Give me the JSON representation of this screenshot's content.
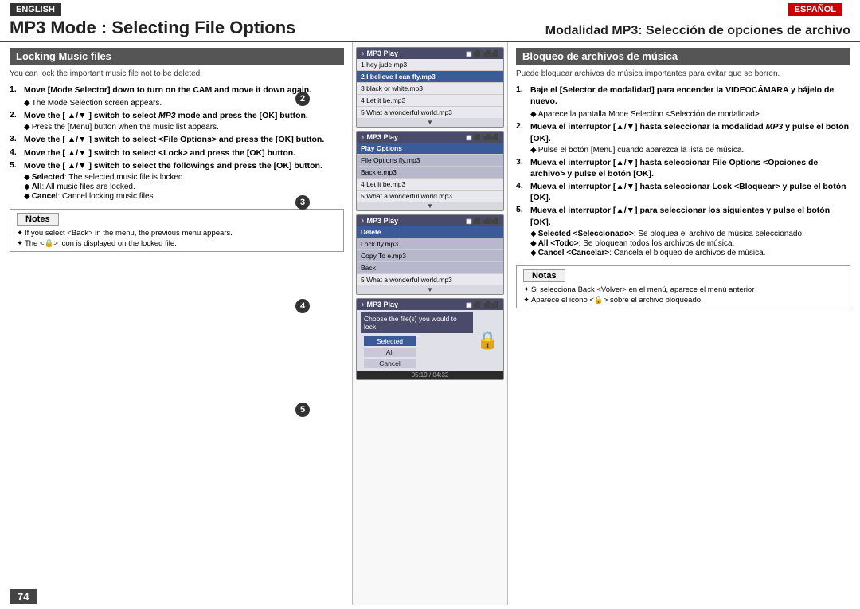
{
  "header": {
    "lang_en": "ENGLISH",
    "lang_es": "ESPAÑOL",
    "title_en": "MP3 Mode : Selecting File Options",
    "title_es": "Modalidad MP3: Selección de opciones de archivo"
  },
  "left": {
    "section_title": "Locking Music files",
    "intro": "You can lock the important music file not to be deleted.",
    "steps": [
      {
        "num": "1.",
        "text": "Move [Mode Selector] down to turn on the CAM and move it down again.",
        "sub": [
          "The Mode Selection screen appears."
        ]
      },
      {
        "num": "2.",
        "text_prefix": "Move the [ ▲/▼ ] switch to select ",
        "italic": "MP3",
        "text_suffix": " mode and press the [OK] button.",
        "sub": [
          "Press the [Menu] button when the music list appears."
        ]
      },
      {
        "num": "3.",
        "text": "Move the [ ▲/▼ ] switch to select <File Options> and press the [OK] button."
      },
      {
        "num": "4.",
        "text": "Move the [ ▲/▼ ] switch to select <Lock> and press the [OK] button."
      },
      {
        "num": "5.",
        "text": "Move the [ ▲/▼ ] switch to select the followings and press the [OK] button.",
        "sub_rich": [
          {
            "bold": "Selected",
            "rest": ": The selected music file is locked."
          },
          {
            "bold": "All",
            "rest": ": All music files are locked."
          },
          {
            "bold": "Cancel",
            "rest": ": Cancel locking music files."
          }
        ]
      }
    ],
    "notes_title": "Notes",
    "notes": [
      "If you select <Back> in the menu, the previous menu appears.",
      "The <🔒> icon is displayed on the locked file."
    ]
  },
  "right": {
    "section_title": "Bloqueo de archivos de música",
    "intro": "Puede bloquear archivos de música importantes para evitar que se borren.",
    "steps": [
      {
        "num": "1.",
        "text": "Baje el [Selector de modalidad] para encender la VIDEOCÁMARA y bájelo de nuevo.",
        "sub": [
          "Aparece la pantalla Mode Selection <Selección de modalidad>."
        ]
      },
      {
        "num": "2.",
        "text_prefix": "Mueva el interruptor [▲/▼] hasta seleccionar la modalidad ",
        "italic": "MP3",
        "text_suffix": " y pulse el botón [OK].",
        "sub": [
          "Pulse el botón [Menu] cuando aparezca la lista de música."
        ]
      },
      {
        "num": "3.",
        "text": "Mueva el interruptor [▲/▼] hasta seleccionar File Options <Opciones de archivo> y pulse el botón [OK]."
      },
      {
        "num": "4.",
        "text": "Mueva el interruptor [▲/▼] hasta seleccionar Lock <Bloquear> y pulse el botón [OK]."
      },
      {
        "num": "5.",
        "text": "Mueva el interruptor [▲/▼] para seleccionar los siguientes y pulse el botón [OK].",
        "sub_rich": [
          {
            "bold": "Selected <Seleccionado>",
            "rest": ": Se bloquea el archivo de música seleccionado."
          },
          {
            "bold": "All <Todo>",
            "rest": ": Se bloquean todos los archivos de música."
          },
          {
            "bold": "Cancel <Cancelar>",
            "rest": ": Cancela el bloqueo de archivos de música."
          }
        ]
      }
    ],
    "notes_title": "Notas",
    "notes": [
      "Si selecciona Back <Volver> en el menú, aparece el menú anterior",
      "Aparece el icono <🔒> sobre el archivo bloqueado."
    ]
  },
  "screens": [
    {
      "step": "2",
      "header": "MP3 Play",
      "rows": [
        {
          "text": "1  hey jude.mp3",
          "highlight": false
        },
        {
          "text": "2  I believe I can fly.mp3",
          "highlight": true
        },
        {
          "text": "3  black or white.mp3",
          "highlight": false
        },
        {
          "text": "4  Let it be.mp3",
          "highlight": false
        },
        {
          "text": "5  What a wonderful world.mp3",
          "highlight": false
        }
      ]
    },
    {
      "step": "3",
      "header": "MP3 Play",
      "rows": [
        {
          "text": "Play Options",
          "highlight": true,
          "menu": true
        },
        {
          "text": "File Options     fly.mp3",
          "highlight": false,
          "menu": true
        },
        {
          "text": "Back               e.mp3",
          "highlight": false,
          "menu": true
        },
        {
          "text": "4  Let it be.mp3",
          "highlight": false
        },
        {
          "text": "5  What a wonderful world.mp3",
          "highlight": false
        }
      ]
    },
    {
      "step": "4",
      "header": "MP3 Play",
      "rows": [
        {
          "text": "Delete",
          "highlight": true,
          "menu": true
        },
        {
          "text": "Lock               fly.mp3",
          "highlight": false,
          "menu": true
        },
        {
          "text": "Copy To          e.mp3",
          "highlight": false,
          "menu": true
        },
        {
          "text": "Back",
          "highlight": false,
          "menu": true
        },
        {
          "text": "5  What a wonderful world.mp3",
          "highlight": false
        }
      ]
    }
  ],
  "screen5": {
    "step": "5",
    "header": "MP3 Play",
    "prompt": "Choose the file(s) you would to lock.",
    "buttons": [
      "Selected",
      "All",
      "Cancel"
    ],
    "time": "05:19 / 04:32"
  },
  "page_number": "74"
}
